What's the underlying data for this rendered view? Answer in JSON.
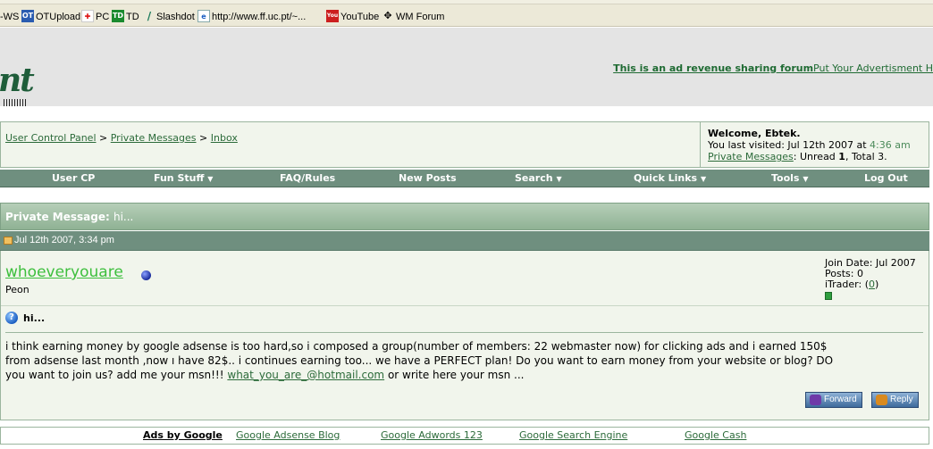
{
  "toolbar": {
    "items": [
      {
        "label": "-WS"
      },
      {
        "icon": "ot-icon",
        "label": "OTUpload"
      },
      {
        "icon": "canada-flag-icon",
        "label": "PC"
      },
      {
        "icon": "td-icon",
        "label": "TD"
      },
      {
        "icon": "slashdot-icon",
        "label": "Slashdot"
      },
      {
        "icon": "ie-page-icon",
        "label": "http://www.ff.uc.pt/~..."
      },
      {
        "icon": "youtube-icon",
        "label": "YouTube"
      },
      {
        "icon": "wm-forum-icon",
        "label": "WM Forum"
      }
    ]
  },
  "header": {
    "logo_fragment": "nt",
    "ad_bold": "This is an ad revenue sharing forum",
    "ad_text": "Put Your Advertisment H"
  },
  "breadcrumb": {
    "items": [
      "User Control Panel",
      "Private Messages",
      "Inbox"
    ],
    "separator": ">"
  },
  "welcome": {
    "greeting": "Welcome, Ebtek.",
    "last_visited_label": "You last visited: Jul 12th 2007 at ",
    "last_visited_time": "4:36 am",
    "pm_link": "Private Messages",
    "pm_unread_label": ": Unread ",
    "pm_unread": "1",
    "pm_total_label": ", Total 3."
  },
  "nav": {
    "items": [
      {
        "label": "User CP",
        "has_menu": false
      },
      {
        "label": "Fun Stuff",
        "has_menu": true
      },
      {
        "label": "FAQ/Rules",
        "has_menu": false
      },
      {
        "label": "New Posts",
        "has_menu": false
      },
      {
        "label": "Search",
        "has_menu": true
      },
      {
        "label": "Quick Links",
        "has_menu": true
      },
      {
        "label": "Tools",
        "has_menu": true
      },
      {
        "label": "Log Out",
        "has_menu": false
      }
    ],
    "menu_arrow": "▼"
  },
  "pm": {
    "title_label": "Private Message:",
    "subject": "hi...",
    "date": "Jul 12th 2007, 3:34 pm",
    "username": "whoeveryouare",
    "user_title": "Peon",
    "join_date": "Join Date: Jul 2007",
    "posts": "Posts: 0",
    "itrader_label": "iTrader: (",
    "itrader_value": "0",
    "itrader_close": ")",
    "message_title": "hi...",
    "body_line1": "i think earning money by google adsense is too hard,so i composed a group(number of members: 22 webmaster now) for clicking ads and i earned 150$",
    "body_line2": "from adsense last month ,now ı have 82$.. i continues earning too... we have a PERFECT plan! Do you want to earn money from your website or blog? DO",
    "body_line3_prefix": "you want to join us? add me your msn!!! ",
    "body_email": "what_you_are_@hotmail.com",
    "body_line3_suffix": " or write here your msn ...",
    "forward_label": "Forward",
    "reply_label": "Reply"
  },
  "ads": {
    "label": "Ads by Google",
    "links": [
      "Google Adsense Blog",
      "Google Adwords 123",
      "Google Search Engine",
      "Google Cash"
    ]
  },
  "colors": {
    "nav_bg": "#6f8f7f",
    "link_green": "#2c6b3a",
    "username_green": "#3dbf3d"
  }
}
